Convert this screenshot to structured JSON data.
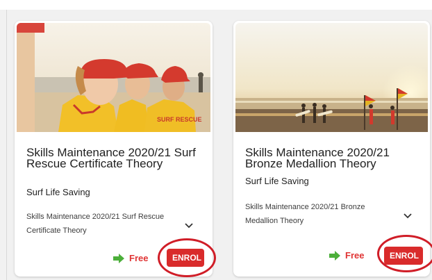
{
  "cards": [
    {
      "title": "Skills Maintenance 2020/21 Surf Rescue Certificate Theory",
      "provider": "Surf Life Saving",
      "description": "Skills Maintenance 2020/21 Surf Rescue Certificate Theory",
      "price": "Free",
      "enrol_label": "ENROL",
      "image_lettering": "SURF RESCUE"
    },
    {
      "title": "Skills Maintenance 2020/21 Bronze Medallion Theory",
      "provider": "Surf Life Saving",
      "description": "Skills Maintenance 2020/21 Bronze Medallion Theory",
      "price": "Free",
      "enrol_label": "ENROL"
    }
  ],
  "icons": {
    "price_icon": "green-arrow-icon",
    "expand_icon": "chevron-down-icon"
  },
  "colors": {
    "enrol_button": "#d92b2b",
    "price_text": "#e03434",
    "price_icon": "#4caf3a",
    "annotation_ring": "#d01d27",
    "card_background": "#ffffff",
    "page_background": "#f1f1f1"
  }
}
